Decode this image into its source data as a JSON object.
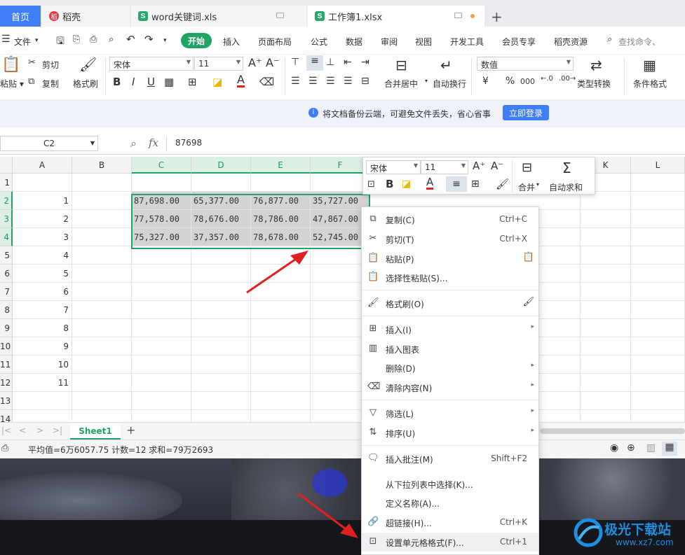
{
  "tabs": {
    "home": "首页",
    "daoke": "稻壳",
    "file1": "word关键词.xls",
    "file2": "工作簿1.xlsx",
    "add": "+"
  },
  "menu": {
    "file": "文件",
    "start": "开始",
    "insert": "插入",
    "layout": "页面布局",
    "formula": "公式",
    "data": "数据",
    "review": "审阅",
    "view": "视图",
    "dev": "开发工具",
    "vip": "会员专享",
    "daoke_res": "稻壳资源",
    "search": "查找命令、"
  },
  "ribbon": {
    "paste": "粘贴",
    "cut": "剪切",
    "copy": "复制",
    "format_painter": "格式刷",
    "font": "宋体",
    "size": "11",
    "merge": "合并居中",
    "wrap": "自动换行",
    "numfmt": "数值",
    "type_convert": "类型转换",
    "cond_format": "条件格式",
    "currency": "¥",
    "percent": "%",
    "thousand": "000"
  },
  "notice": {
    "text": "将文档备份云端，可避免文件丢失，省心省事",
    "login": "立即登录"
  },
  "formula": {
    "cellref": "C2",
    "fx": "fx",
    "value": "87698"
  },
  "grid": {
    "columns": [
      "A",
      "B",
      "C",
      "D",
      "E",
      "F",
      "K",
      "L"
    ],
    "row_numbers": [
      "1",
      "2",
      "3",
      "4",
      "5",
      "6",
      "7",
      "8",
      "9",
      "10",
      "11",
      "12",
      "13",
      "14"
    ],
    "a_values": [
      "",
      "1",
      "2",
      "3",
      "4",
      "5",
      "6",
      "7",
      "8",
      "9",
      "10",
      "11",
      "",
      ""
    ],
    "rows": [
      [
        "87,698.00",
        "65,377.00",
        "76,877.00",
        "35,727.00"
      ],
      [
        "77,578.00",
        "78,676.00",
        "78,786.00",
        "47,867.00"
      ],
      [
        "75,327.00",
        "37,357.00",
        "78,678.00",
        "52,745.00"
      ]
    ]
  },
  "sheet": {
    "name": "Sheet1",
    "add": "+"
  },
  "status": {
    "text": "平均值=6万6057.75  计数=12  求和=79万2693"
  },
  "mini_toolbar": {
    "font": "宋体",
    "size": "11",
    "merge": "合并",
    "autosum": "自动求和",
    "bold": "B"
  },
  "context_menu": [
    {
      "label": "复制(C)",
      "shortcut": "Ctrl+C",
      "icon": "copy-icon"
    },
    {
      "label": "剪切(T)",
      "shortcut": "Ctrl+X",
      "icon": "scissors-icon"
    },
    {
      "label": "粘贴(P)",
      "shortcut": "",
      "icon": "paste-icon"
    },
    {
      "label": "选择性粘贴(S)...",
      "shortcut": "",
      "icon": "paste-special-icon"
    },
    {
      "label": "格式刷(O)",
      "shortcut": "",
      "icon": "format-painter-icon"
    },
    {
      "label": "插入(I)",
      "shortcut": "",
      "icon": "insert-icon",
      "submenu": true
    },
    {
      "label": "插入图表",
      "shortcut": "",
      "icon": "chart-icon"
    },
    {
      "label": "删除(D)",
      "shortcut": "",
      "icon": "",
      "submenu": true
    },
    {
      "label": "清除内容(N)",
      "shortcut": "",
      "icon": "eraser-icon",
      "submenu": true
    },
    {
      "label": "筛选(L)",
      "shortcut": "",
      "icon": "filter-icon",
      "submenu": true
    },
    {
      "label": "排序(U)",
      "shortcut": "",
      "icon": "sort-icon",
      "submenu": true
    },
    {
      "label": "插入批注(M)",
      "shortcut": "Shift+F2",
      "icon": "comment-icon"
    },
    {
      "label": "从下拉列表中选择(K)...",
      "shortcut": "",
      "icon": ""
    },
    {
      "label": "定义名称(A)...",
      "shortcut": "",
      "icon": ""
    },
    {
      "label": "超链接(H)...",
      "shortcut": "Ctrl+K",
      "icon": "link-icon"
    },
    {
      "label": "设置单元格格式(F)...",
      "shortcut": "Ctrl+1",
      "icon": "cell-format-icon"
    }
  ],
  "watermark": {
    "title": "极光下载站",
    "url": "www.xz7.com"
  },
  "colors": {
    "accent_green": "#21a366",
    "accent_blue": "#3f7ef6",
    "arrow_red": "#e02020"
  }
}
